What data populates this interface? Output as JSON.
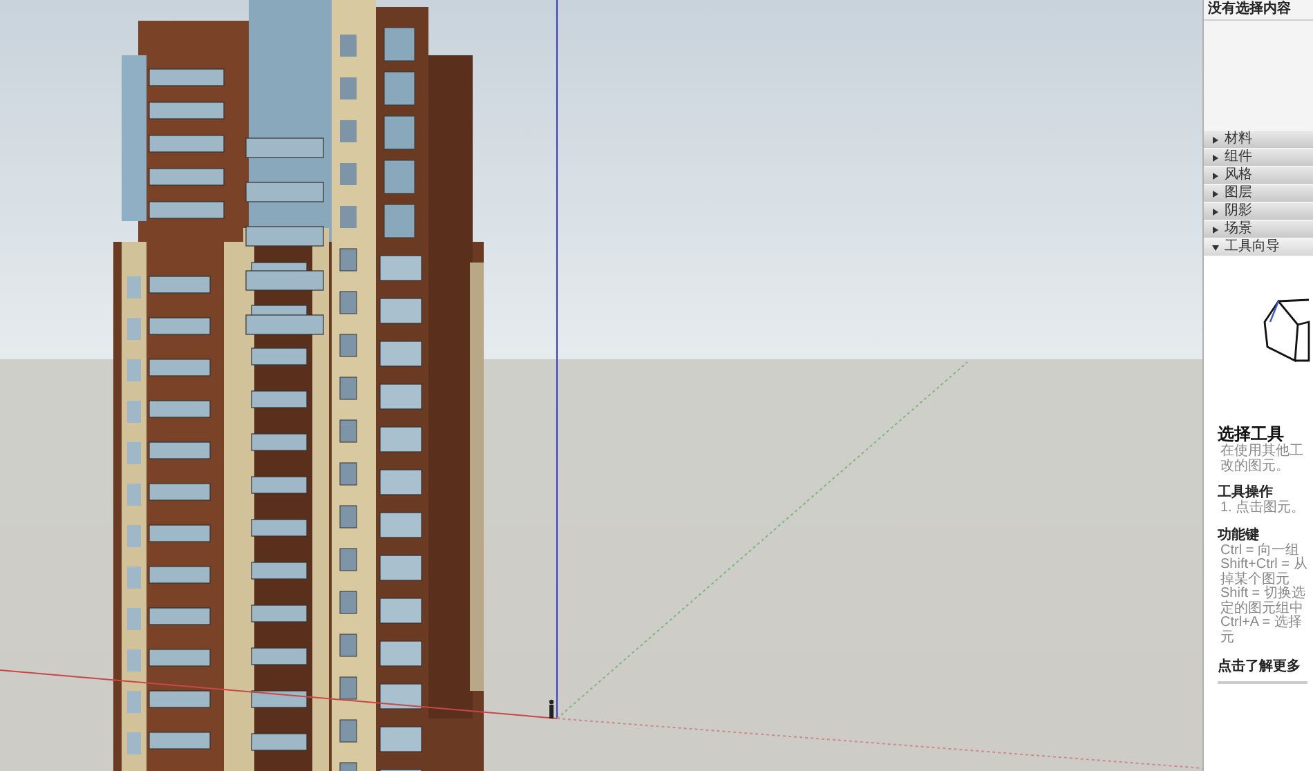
{
  "panel": {
    "header": "没有选择内容",
    "trays": [
      {
        "label": "材料",
        "expanded": false
      },
      {
        "label": "组件",
        "expanded": false
      },
      {
        "label": "风格",
        "expanded": false
      },
      {
        "label": "图层",
        "expanded": false
      },
      {
        "label": "阴影",
        "expanded": false
      },
      {
        "label": "场景",
        "expanded": false
      },
      {
        "label": "工具向导",
        "expanded": true
      }
    ],
    "instructor": {
      "title": "选择工具",
      "description": [
        "在使用其他工",
        "改的图元。"
      ],
      "sections": [
        {
          "heading": "工具操作",
          "lines": [
            "1.  点击图元。"
          ]
        },
        {
          "heading": "功能键",
          "lines": [
            "Ctrl = 向一组",
            "Shift+Ctrl = 从",
            "掉某个图元",
            "Shift = 切换选",
            "定的图元组中",
            "Ctrl+A = 选择",
            "元"
          ]
        }
      ],
      "link": "点击了解更多"
    }
  }
}
